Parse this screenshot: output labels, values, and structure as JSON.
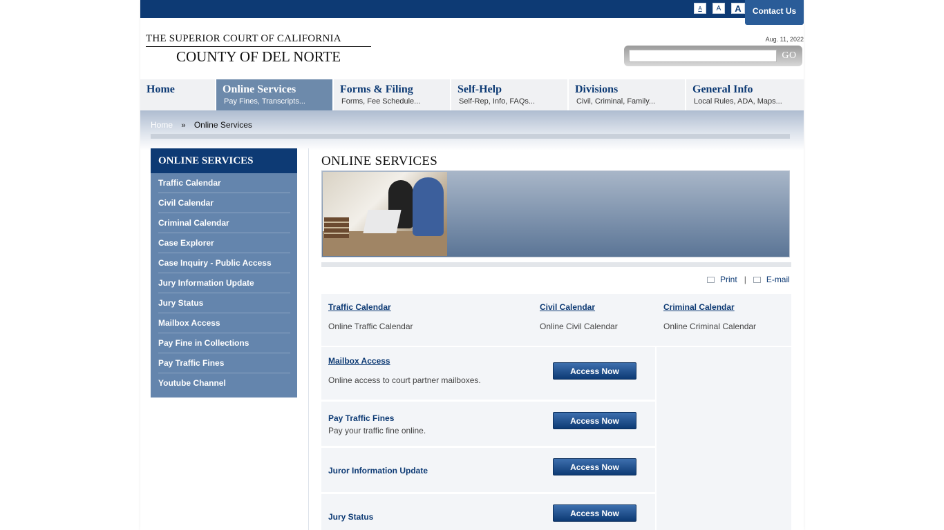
{
  "topbar": {
    "font_small": "A",
    "font_medium": "A",
    "font_large": "A",
    "contact": "Contact Us"
  },
  "logo": {
    "line1": "THE SUPERIOR COURT OF CALIFORNIA",
    "line2": "COUNTY OF DEL NORTE"
  },
  "date": "Aug. 11, 2022",
  "search": {
    "value": "",
    "placeholder": "",
    "go_label": "GO"
  },
  "nav": [
    {
      "title": "Home",
      "sub": ""
    },
    {
      "title": "Online Services",
      "sub": "Pay Fines, Transcripts..."
    },
    {
      "title": "Forms & Filing",
      "sub": "Forms, Fee Schedule..."
    },
    {
      "title": "Self-Help",
      "sub": "Self-Rep, Info, FAQs..."
    },
    {
      "title": "Divisions",
      "sub": "Civil, Criminal, Family..."
    },
    {
      "title": "General Info",
      "sub": "Local Rules, ADA, Maps..."
    }
  ],
  "breadcrumb": {
    "home": "Home",
    "sep": "»",
    "current": "Online Services"
  },
  "sidebar": {
    "heading": "ONLINE SERVICES",
    "items": [
      "Traffic Calendar",
      "Civil Calendar",
      "Criminal Calendar",
      "Case Explorer",
      "Case Inquiry - Public Access",
      "Jury Information Update",
      "Jury Status",
      "Mailbox Access",
      "Pay Fine in Collections",
      "Pay Traffic Fines",
      "Youtube Channel"
    ]
  },
  "content": {
    "title": "ONLINE SERVICES",
    "print": "Print",
    "tool_sep": "|",
    "email": "E-mail",
    "calendars": [
      {
        "link": "Traffic Calendar",
        "desc": "Online Traffic Calendar"
      },
      {
        "link": "Civil Calendar",
        "desc": "Online Civil Calendar"
      },
      {
        "link": "Criminal Calendar",
        "desc": "Online Criminal Calendar"
      }
    ],
    "services": [
      {
        "title": "Mailbox Access",
        "desc": "Online access to court partner mailboxes.",
        "button": "Access Now"
      },
      {
        "title": "Pay Traffic Fines",
        "desc": "Pay your traffic fine online.",
        "button": "Access Now"
      },
      {
        "title": "Juror Information Update",
        "desc": "",
        "button": "Access Now"
      },
      {
        "title": "Jury Status",
        "desc": "",
        "button": "Access Now"
      }
    ]
  },
  "colors": {
    "brand_navy": "#0d3a74",
    "sidebar_blue": "#6485ad",
    "active_tab": "#6d8aab"
  }
}
